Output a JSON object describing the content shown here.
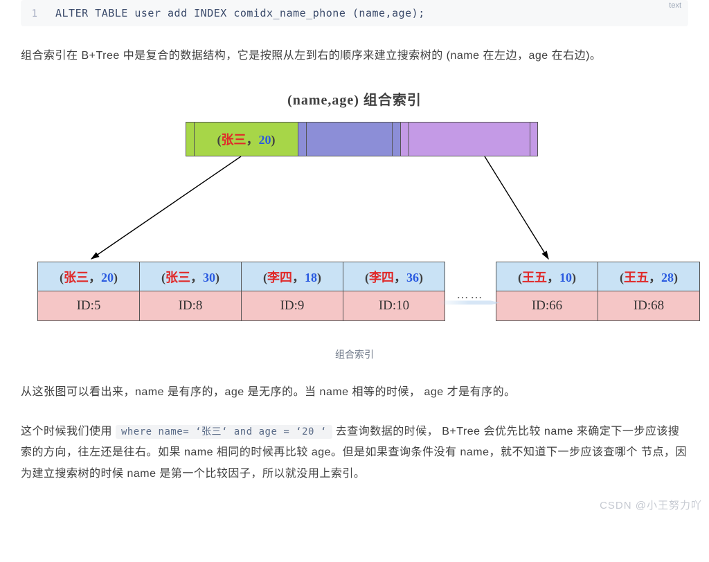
{
  "code": {
    "lang": "text",
    "line_num": "1",
    "content": "ALTER TABLE user add INDEX comidx_name_phone (name,age);"
  },
  "para1": "组合索引在 B+Tree 中是复合的数据结构，它是按照从左到右的顺序来建立搜索树的 (name 在左边，age 在右边)。",
  "diagram": {
    "title": "(name,age)  组合索引",
    "root_key_name": "张三",
    "root_key_sep": "，",
    "root_key_age": "20",
    "leaves": [
      {
        "name": "张三",
        "age": "20",
        "id": "ID:5"
      },
      {
        "name": "张三",
        "age": "30",
        "id": "ID:8"
      },
      {
        "name": "李四",
        "age": "18",
        "id": "ID:9"
      },
      {
        "name": "李四",
        "age": "36",
        "id": "ID:10"
      },
      {
        "name": "王五",
        "age": "10",
        "id": "ID:66"
      },
      {
        "name": "王五",
        "age": "28",
        "id": "ID:68"
      }
    ],
    "ellipsis": "……"
  },
  "caption": "组合索引",
  "para2": "从这张图可以看出来，name 是有序的，age 是无序的。当 name 相等的时候， age 才是有序的。",
  "para3_pre": "这个时候我们使用 ",
  "para3_code": "where name= ‘张三‘ and age = ‘20 ‘",
  "para3_post": " 去查询数据的时候， B+Tree 会优先比较 name 来确定下一步应该搜索的方向，往左还是往右。如果 name 相同的时候再比较 age。但是如果查询条件没有 name，就不知道下一步应该查哪个 节点，因为建立搜索树的时候 name 是第一个比较因子，所以就没用上索引。",
  "watermark": "CSDN @小王努力吖"
}
